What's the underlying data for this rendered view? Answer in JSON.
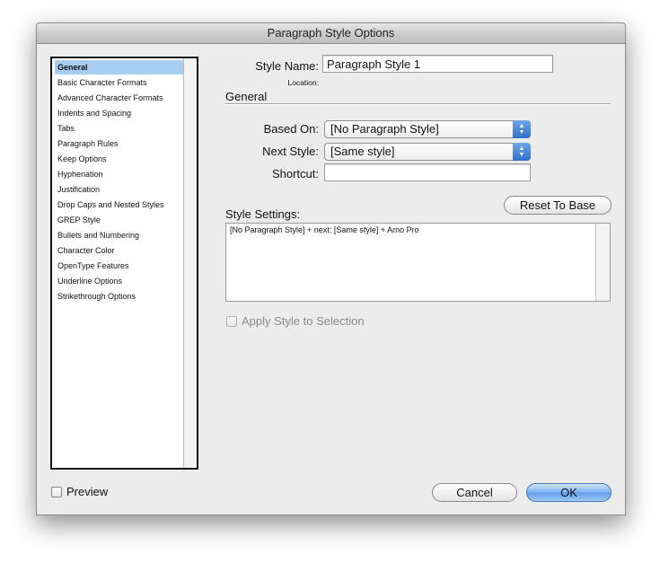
{
  "window": {
    "title": "Paragraph Style Options"
  },
  "sidebar": {
    "items": [
      {
        "label": "General",
        "selected": true
      },
      {
        "label": "Basic Character Formats"
      },
      {
        "label": "Advanced Character Formats"
      },
      {
        "label": "Indents and Spacing"
      },
      {
        "label": "Tabs"
      },
      {
        "label": "Paragraph Rules"
      },
      {
        "label": "Keep Options"
      },
      {
        "label": "Hyphenation"
      },
      {
        "label": "Justification"
      },
      {
        "label": "Drop Caps and Nested Styles"
      },
      {
        "label": "GREP Style"
      },
      {
        "label": "Bullets and Numbering"
      },
      {
        "label": "Character Color"
      },
      {
        "label": "OpenType Features"
      },
      {
        "label": "Underline Options"
      },
      {
        "label": "Strikethrough Options"
      }
    ]
  },
  "form": {
    "style_name_label": "Style Name:",
    "style_name_value": "Paragraph Style 1",
    "location_label": "Location:",
    "section_title": "General",
    "based_on_label": "Based On:",
    "based_on_value": "[No Paragraph Style]",
    "next_style_label": "Next Style:",
    "next_style_value": "[Same style]",
    "shortcut_label": "Shortcut:",
    "shortcut_value": "",
    "reset_button": "Reset To Base",
    "style_settings_label": "Style Settings:",
    "style_settings_text": "[No Paragraph Style] + next: [Same style] + Arno Pro",
    "apply_label": "Apply Style to Selection",
    "apply_checked": false
  },
  "footer": {
    "preview_label": "Preview",
    "preview_checked": false,
    "cancel_label": "Cancel",
    "ok_label": "OK"
  },
  "colors": {
    "selection": "#a7cdf0",
    "default_button": "#6aa6ec"
  }
}
